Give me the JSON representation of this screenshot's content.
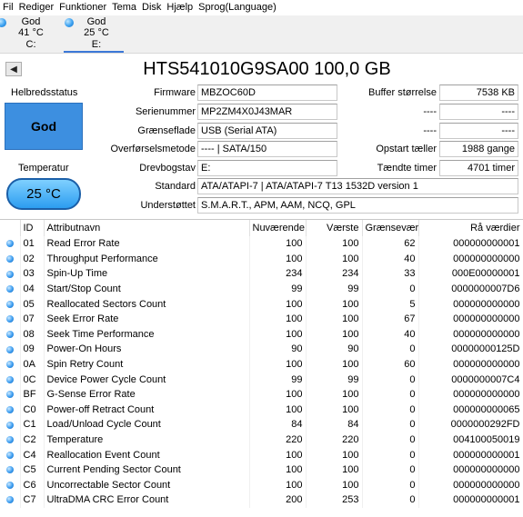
{
  "menu": [
    "Fil",
    "Rediger",
    "Funktioner",
    "Tema",
    "Disk",
    "Hjælp",
    "Sprog(Language)"
  ],
  "drives": [
    {
      "status": "God",
      "temp": "41 °C",
      "letter": "C:"
    },
    {
      "status": "God",
      "temp": "25 °C",
      "letter": "E:"
    }
  ],
  "disk_title": "HTS541010G9SA00 100,0 GB",
  "health": {
    "label": "Helbredsstatus",
    "value": "God",
    "color": "#3d8fe0"
  },
  "temperature": {
    "label": "Temperatur",
    "value": "25 °C"
  },
  "fields": {
    "firmware": {
      "label": "Firmware",
      "value": "MBZOC60D"
    },
    "serial": {
      "label": "Serienummer",
      "value": "MP2ZM4X0J43MAR"
    },
    "interface": {
      "label": "Grænseflade",
      "value": "USB (Serial ATA)"
    },
    "transfer": {
      "label": "Overførselsmetode",
      "value": "---- | SATA/150"
    },
    "drive_letter": {
      "label": "Drevbogstav",
      "value": "E:"
    },
    "standard": {
      "label": "Standard",
      "value": "ATA/ATAPI-7 | ATA/ATAPI-7 T13 1532D version 1"
    },
    "supported": {
      "label": "Understøttet",
      "value": "S.M.A.R.T., APM, AAM, NCQ, GPL"
    },
    "buffer": {
      "label": "Buffer størrelse",
      "value": "7538 KB"
    },
    "r2": {
      "label": "----",
      "value": "----"
    },
    "r3": {
      "label": "----",
      "value": "----"
    },
    "power_count": {
      "label": "Opstart tæller",
      "value": "1988 gange"
    },
    "power_hours": {
      "label": "Tændte timer",
      "value": "4701 timer"
    }
  },
  "table": {
    "headers": [
      "ID",
      "Attributnavn",
      "Nuværende",
      "Værste",
      "Grænseværdi",
      "Rå værdier"
    ],
    "rows": [
      [
        "01",
        "Read Error Rate",
        "100",
        "100",
        "62",
        "000000000001"
      ],
      [
        "02",
        "Throughput Performance",
        "100",
        "100",
        "40",
        "000000000000"
      ],
      [
        "03",
        "Spin-Up Time",
        "234",
        "234",
        "33",
        "000E00000001"
      ],
      [
        "04",
        "Start/Stop Count",
        "99",
        "99",
        "0",
        "0000000007D6"
      ],
      [
        "05",
        "Reallocated Sectors Count",
        "100",
        "100",
        "5",
        "000000000000"
      ],
      [
        "07",
        "Seek Error Rate",
        "100",
        "100",
        "67",
        "000000000000"
      ],
      [
        "08",
        "Seek Time Performance",
        "100",
        "100",
        "40",
        "000000000000"
      ],
      [
        "09",
        "Power-On Hours",
        "90",
        "90",
        "0",
        "00000000125D"
      ],
      [
        "0A",
        "Spin Retry Count",
        "100",
        "100",
        "60",
        "000000000000"
      ],
      [
        "0C",
        "Device Power Cycle Count",
        "99",
        "99",
        "0",
        "0000000007C4"
      ],
      [
        "BF",
        "G-Sense Error Rate",
        "100",
        "100",
        "0",
        "000000000000"
      ],
      [
        "C0",
        "Power-off Retract Count",
        "100",
        "100",
        "0",
        "000000000065"
      ],
      [
        "C1",
        "Load/Unload Cycle Count",
        "84",
        "84",
        "0",
        "0000000292FD"
      ],
      [
        "C2",
        "Temperature",
        "220",
        "220",
        "0",
        "004100050019"
      ],
      [
        "C4",
        "Reallocation Event Count",
        "100",
        "100",
        "0",
        "000000000001"
      ],
      [
        "C5",
        "Current Pending Sector Count",
        "100",
        "100",
        "0",
        "000000000000"
      ],
      [
        "C6",
        "Uncorrectable Sector Count",
        "100",
        "100",
        "0",
        "000000000000"
      ],
      [
        "C7",
        "UltraDMA CRC Error Count",
        "200",
        "253",
        "0",
        "000000000001"
      ]
    ]
  }
}
